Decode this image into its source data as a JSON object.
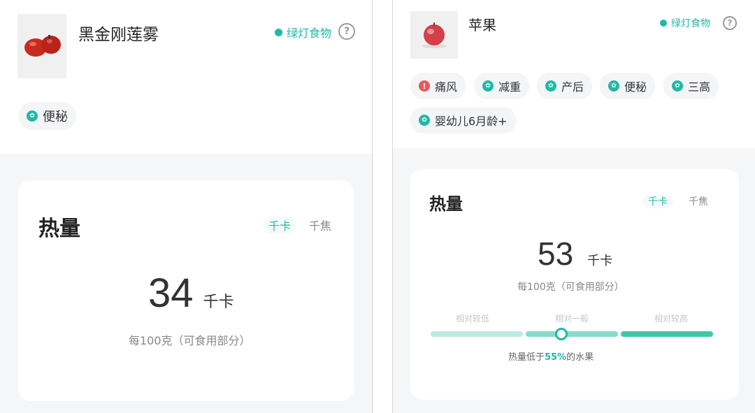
{
  "left": {
    "food_name": "黑金刚莲雾",
    "green_tag": "绿灯食物",
    "help": "?",
    "tags": [
      {
        "label": "便秘",
        "type": "good"
      }
    ],
    "energy": {
      "title": "热量",
      "units": [
        "千卡",
        "千焦"
      ],
      "active_unit": "千卡",
      "value": "34",
      "value_unit": "千卡",
      "per": "每100克（可食用部分）"
    }
  },
  "right": {
    "food_name": "苹果",
    "green_tag": "绿灯食物",
    "help": "?",
    "tags": [
      {
        "label": "痛风",
        "type": "warn"
      },
      {
        "label": "减重",
        "type": "good"
      },
      {
        "label": "产后",
        "type": "good"
      },
      {
        "label": "便秘",
        "type": "good"
      },
      {
        "label": "三高",
        "type": "good"
      },
      {
        "label": "婴幼儿6月龄+",
        "type": "good"
      }
    ],
    "energy": {
      "title": "热量",
      "units": [
        "千卡",
        "千焦"
      ],
      "active_unit": "千卡",
      "value": "53",
      "value_unit": "千卡",
      "per": "每100克（可食用部分）",
      "scale_labels": [
        "相对较低",
        "相对一般",
        "相对较高"
      ],
      "note_prefix": "热量低于",
      "note_pct": "55%",
      "note_suffix": "的水果",
      "percentile": 0.55
    }
  },
  "colors": {
    "accent": "#21b9a6",
    "warn": "#e8575b"
  }
}
